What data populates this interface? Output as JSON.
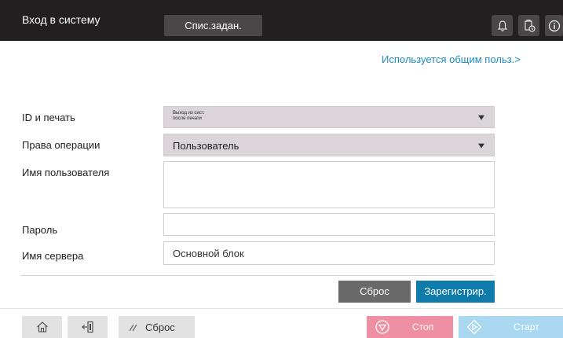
{
  "header": {
    "title": "Вход в систему",
    "jobs_label": "Спис.задан."
  },
  "shared_link": "Используется общим польз.>",
  "form": {
    "id_print": {
      "label": "ID и печать",
      "value": "Выход из сист.\nпосле печати"
    },
    "operation_rights": {
      "label": "Права операции",
      "value": "Пользователь"
    },
    "username": {
      "label": "Имя пользователя",
      "value": ""
    },
    "password": {
      "label": "Пароль",
      "value": ""
    },
    "server": {
      "label": "Имя сервера",
      "value": "Основной блок"
    }
  },
  "actions": {
    "reset_label": "Сброс",
    "register_label": "Зарегистрир."
  },
  "footer": {
    "reset_label": "Сброс",
    "stop_label": "Стоп",
    "start_label": "Старт"
  },
  "colors": {
    "header_bg": "#231f20",
    "link": "#1e8bc3",
    "register": "#0f7bab",
    "stop": "#ee8fa3",
    "start": "#a9d8f0"
  },
  "icons": [
    "bell-icon",
    "job-status-icon",
    "info-icon",
    "home-icon",
    "logout-icon",
    "reset-icon",
    "stop-icon",
    "start-icon"
  ]
}
